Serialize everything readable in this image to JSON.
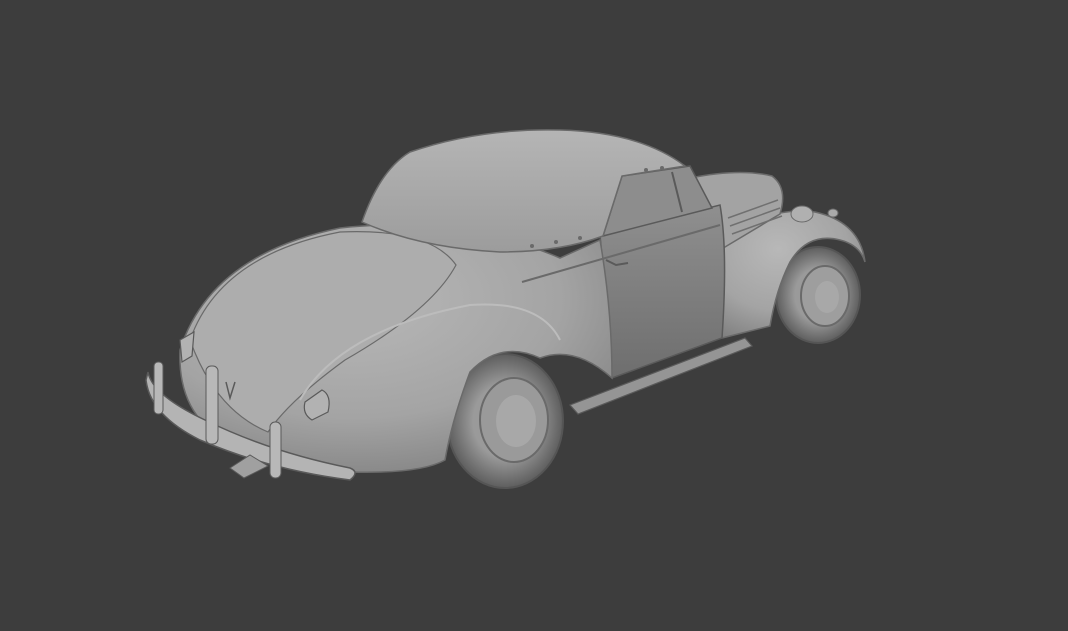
{
  "viewport": {
    "background": "#3d3d3d",
    "model_color": "#a9a9a9",
    "edge_color": "#5a5a5a",
    "subject": "car-model-icon"
  }
}
